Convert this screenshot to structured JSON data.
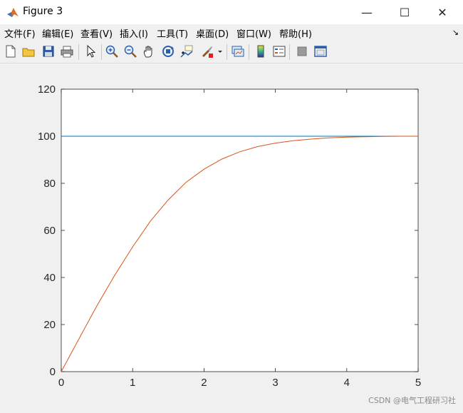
{
  "window": {
    "title": "Figure 3",
    "minimize_glyph": "—",
    "maximize_glyph": "☐",
    "close_glyph": "✕"
  },
  "menu": {
    "items": [
      {
        "label": "文件(F)"
      },
      {
        "label": "编辑(E)"
      },
      {
        "label": "查看(V)"
      },
      {
        "label": "插入(I)"
      },
      {
        "label": "工具(T)"
      },
      {
        "label": "桌面(D)"
      },
      {
        "label": "窗口(W)"
      },
      {
        "label": "帮助(H)"
      }
    ],
    "dock_arrow": "↘"
  },
  "toolbar": {
    "icons": [
      "new-figure-icon",
      "open-file-icon",
      "save-icon",
      "print-icon",
      "pointer-icon",
      "zoom-in-icon",
      "zoom-out-icon",
      "pan-hand-icon",
      "rotate-3d-icon",
      "data-cursor-icon",
      "brush-icon",
      "link-plot-icon",
      "colorbar-icon",
      "legend-icon",
      "hide-plot-tools-icon",
      "show-plot-tools-icon"
    ]
  },
  "chart_data": {
    "type": "line",
    "title": "",
    "xlabel": "",
    "ylabel": "",
    "xlim": [
      0,
      5
    ],
    "ylim": [
      0,
      120
    ],
    "xticks": [
      "0",
      "1",
      "2",
      "3",
      "4",
      "5"
    ],
    "yticks": [
      "0",
      "20",
      "40",
      "60",
      "80",
      "100",
      "120"
    ],
    "grid": false,
    "series": [
      {
        "color": "#0072BD",
        "x": [
          0,
          5
        ],
        "y": [
          100,
          100
        ]
      },
      {
        "color": "#D95319",
        "x": [
          0,
          0.25,
          0.5,
          0.75,
          1,
          1.25,
          1.5,
          1.75,
          2,
          2.25,
          2.5,
          2.75,
          3,
          3.25,
          3.5,
          3.75,
          4,
          4.25,
          4.5,
          4.75,
          5
        ],
        "y": [
          0,
          14,
          28,
          41,
          53,
          64,
          73,
          80.5,
          86,
          90.3,
          93.4,
          95.6,
          97.1,
          98.1,
          98.8,
          99.3,
          99.6,
          99.8,
          99.9,
          100,
          100
        ]
      }
    ]
  },
  "watermark": "CSDN @电气工程研习社"
}
